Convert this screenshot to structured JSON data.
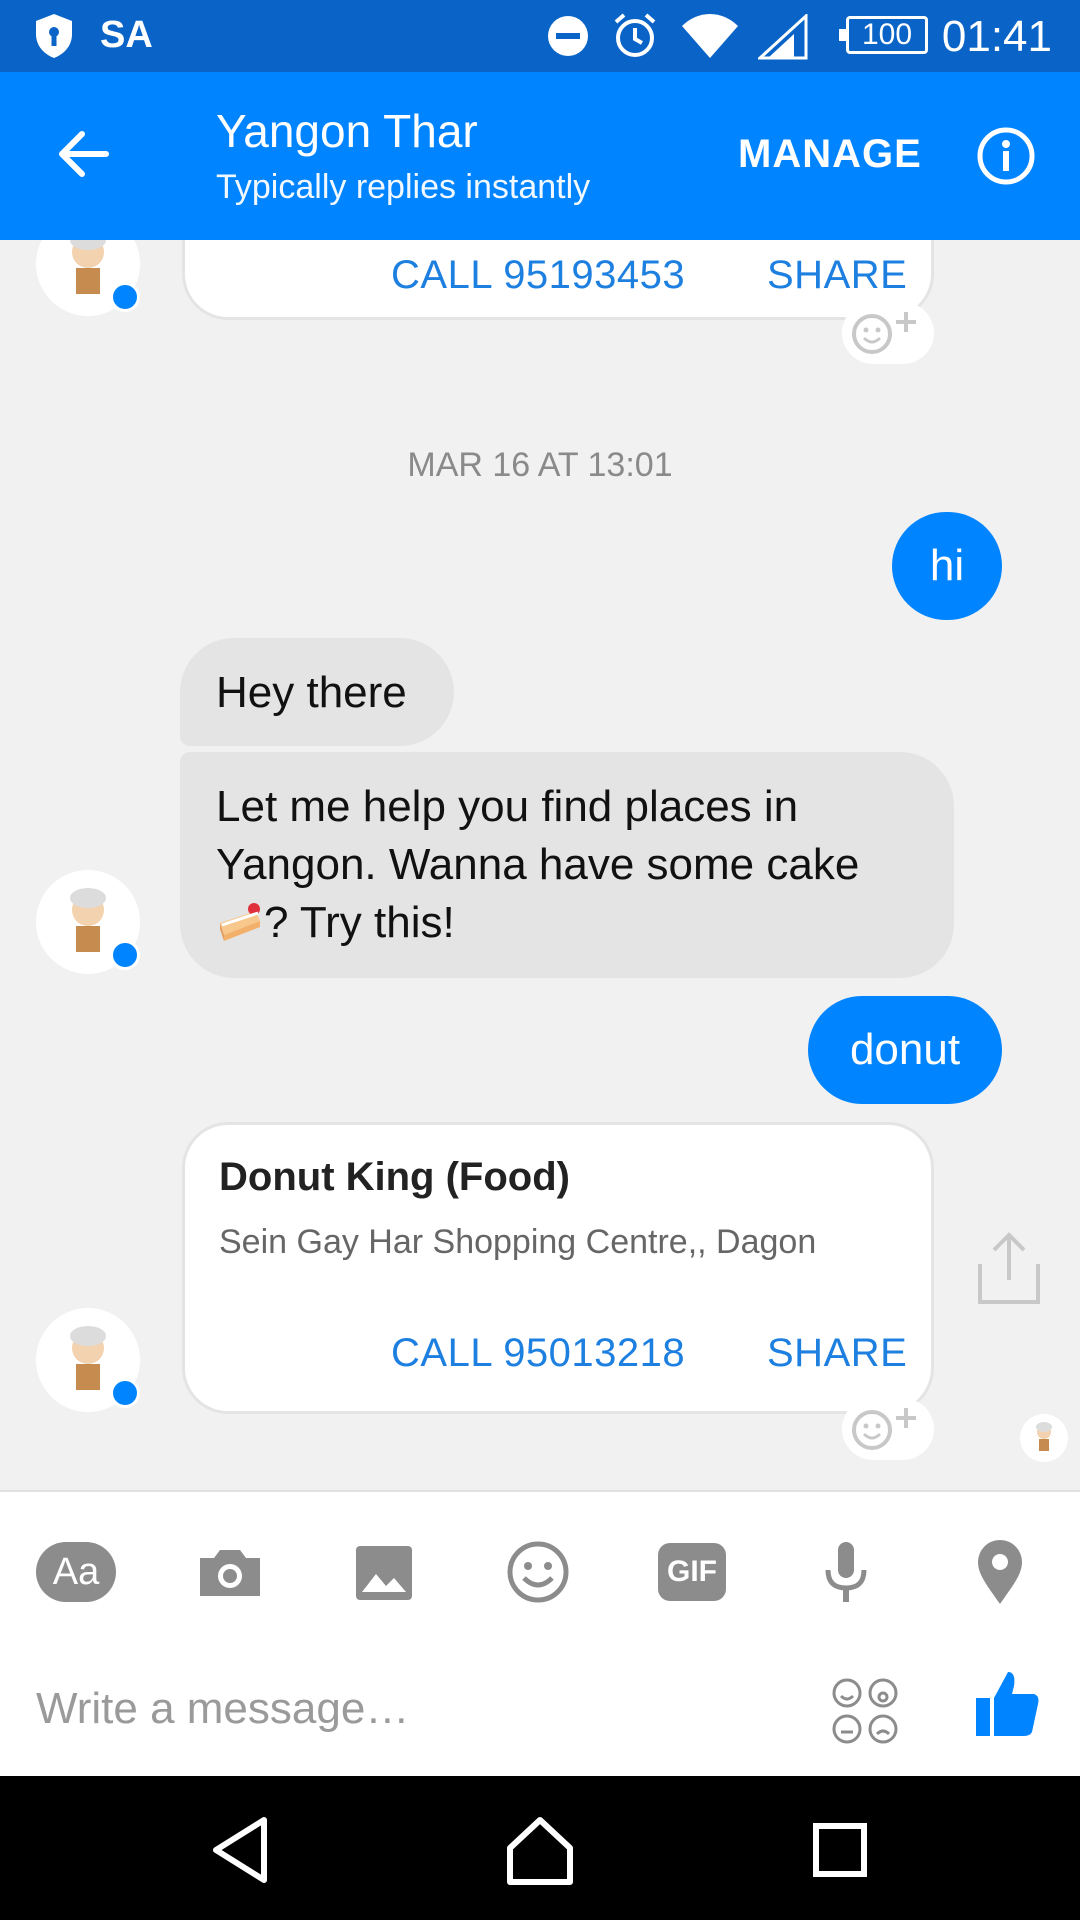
{
  "status_bar": {
    "carrier": "SA",
    "battery": "100",
    "time": "01:41"
  },
  "header": {
    "title": "Yangon Thar",
    "subtitle": "Typically replies instantly",
    "manage": "MANAGE"
  },
  "card_prev": {
    "call": "CALL 95193453",
    "share": "SHARE"
  },
  "timestamp": "MAR 16 AT 13:01",
  "messages": {
    "out_hi": "hi",
    "in_hey": "Hey there",
    "in_help_line1": "Let me help you find places in",
    "in_help_line2": "Yangon. Wanna have some cake",
    "in_help_line3": "? Try this!",
    "out_donut": "donut"
  },
  "card_donut": {
    "title": "Donut King (Food)",
    "address": "Sein Gay Har Shopping Centre,, Dagon",
    "call": "CALL 95013218",
    "share": "SHARE"
  },
  "composer": {
    "placeholder": "Write a message…",
    "text_button": "Aa",
    "gif_button": "GIF"
  },
  "colors": {
    "brand": "#0084ff",
    "status_bar": "#0a64c8",
    "link": "#1d80e0",
    "incoming_bubble": "#e4e4e4"
  },
  "icons": [
    "shield-icon",
    "dnd-icon",
    "alarm-icon",
    "wifi-icon",
    "signal-icon",
    "back-arrow-icon",
    "info-icon",
    "camera-icon",
    "image-icon",
    "emoji-icon",
    "mic-icon",
    "location-icon",
    "stickers-icon",
    "thumbs-up-icon",
    "share-icon",
    "add-reaction-icon",
    "cake-emoji-icon"
  ]
}
